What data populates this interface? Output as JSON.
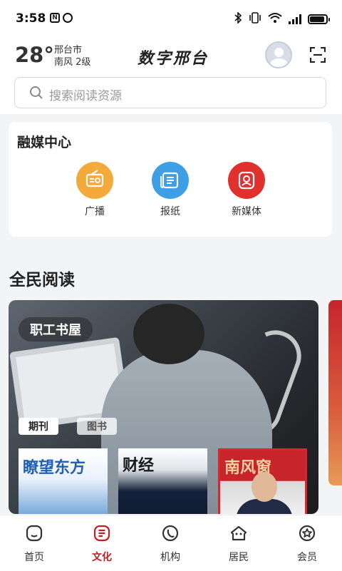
{
  "status_bar": {
    "time": "3:58",
    "mini_icons": [
      "N",
      "⏰"
    ],
    "right_icons": [
      "bluetooth-icon",
      "vibrate-icon",
      "wifi-icon",
      "signal-icon",
      "battery-icon"
    ],
    "battery_level": 0.9
  },
  "header": {
    "temperature": "28°",
    "city": "邢台市",
    "wind": "南风  2级",
    "app_title": "数字邢台",
    "search_placeholder": "搜索阅读资源"
  },
  "media_center": {
    "title": "融媒中心",
    "items": [
      {
        "label": "广播",
        "icon": "radio-icon",
        "color": "#f4a93b"
      },
      {
        "label": "报纸",
        "icon": "newspaper-icon",
        "color": "#3e9fe6"
      },
      {
        "label": "新媒体",
        "icon": "new-media-icon",
        "color": "#e0312f"
      }
    ]
  },
  "reading": {
    "title": "全民阅读",
    "banner_label": "职工书屋",
    "chips": [
      "期刊",
      "图书"
    ],
    "magazines": [
      "瞭望东方",
      "财经",
      "南风窗"
    ]
  },
  "bottom_nav": {
    "items": [
      {
        "label": "首页",
        "icon": "home-icon",
        "active": false
      },
      {
        "label": "文化",
        "icon": "culture-icon",
        "active": true
      },
      {
        "label": "机构",
        "icon": "institution-icon",
        "active": false
      },
      {
        "label": "居民",
        "icon": "resident-icon",
        "active": false
      },
      {
        "label": "会员",
        "icon": "member-icon",
        "active": false
      }
    ],
    "active_color": "#c21d24"
  }
}
